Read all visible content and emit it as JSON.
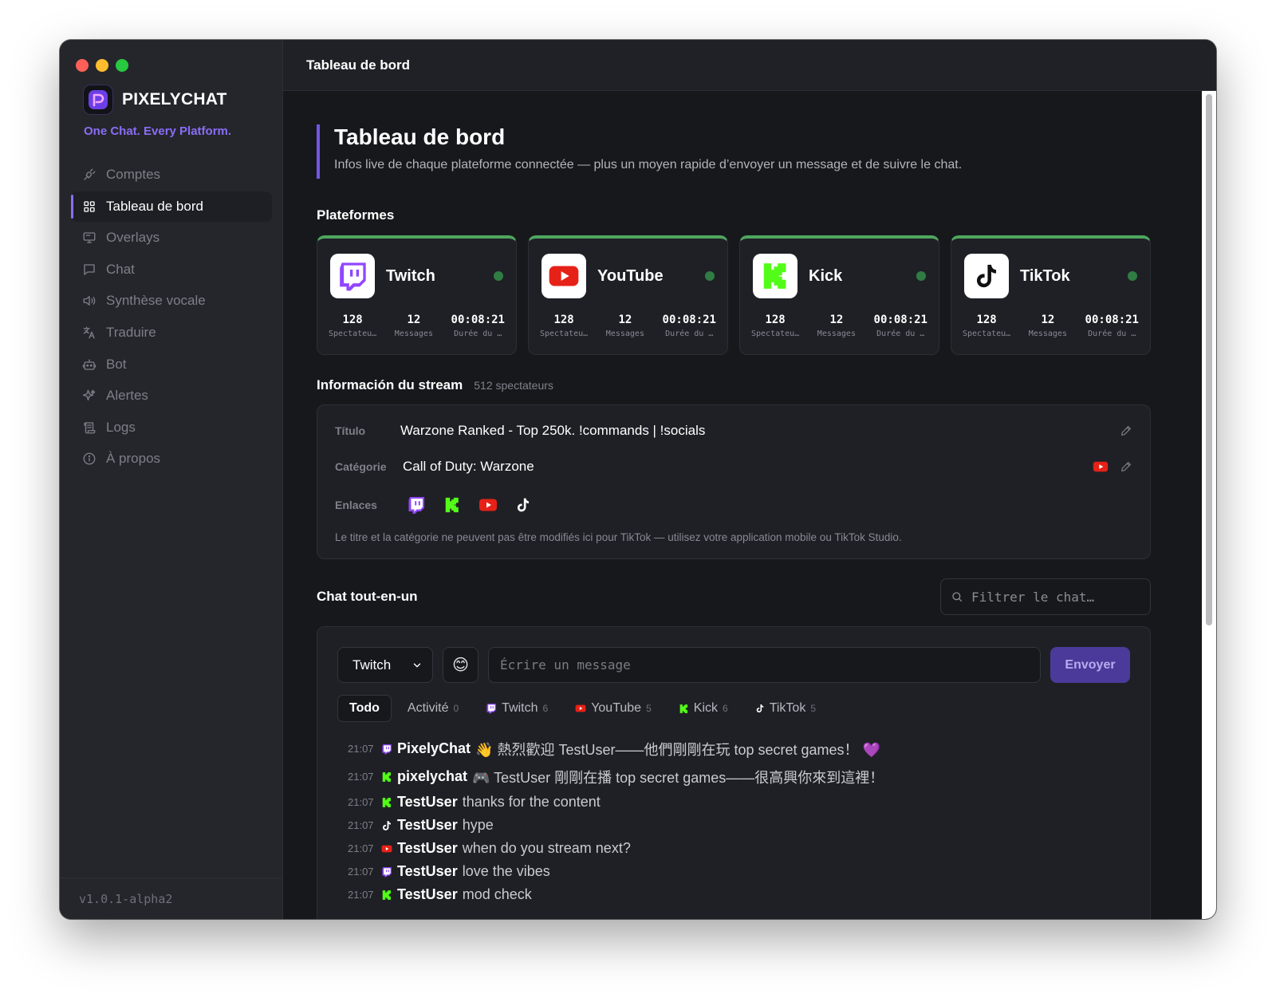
{
  "app": {
    "name": "PIXELYCHAT",
    "tagline": "One Chat. Every Platform.",
    "version": "v1.0.1-alpha2",
    "topbar_title": "Tableau de bord",
    "accent": "#8a6df5"
  },
  "sidebar": {
    "items": [
      {
        "label": "Comptes",
        "icon": "plug-icon"
      },
      {
        "label": "Tableau de bord",
        "icon": "grid-icon"
      },
      {
        "label": "Overlays",
        "icon": "monitor-icon"
      },
      {
        "label": "Chat",
        "icon": "message-icon"
      },
      {
        "label": "Synthèse vocale",
        "icon": "speaker-icon"
      },
      {
        "label": "Traduire",
        "icon": "translate-icon"
      },
      {
        "label": "Bot",
        "icon": "bot-icon"
      },
      {
        "label": "Alertes",
        "icon": "sparkles-icon"
      },
      {
        "label": "Logs",
        "icon": "scroll-icon"
      },
      {
        "label": "À propos",
        "icon": "info-icon"
      }
    ]
  },
  "page": {
    "title": "Tableau de bord",
    "subtitle": "Infos live de chaque plateforme connectée — plus un moyen rapide d’envoyer un message et de suivre le chat."
  },
  "platforms": {
    "title": "Plateformes",
    "cards": [
      {
        "name": "Twitch",
        "viewers": "128",
        "messages": "12",
        "duration": "00:08:21",
        "viewers_label": "Spectateu…",
        "messages_label": "Messages",
        "duration_label": "Durée du …",
        "color": "#9146ff"
      },
      {
        "name": "YouTube",
        "viewers": "128",
        "messages": "12",
        "duration": "00:08:21",
        "viewers_label": "Spectateu…",
        "messages_label": "Messages",
        "duration_label": "Durée du …",
        "color": "#e62117"
      },
      {
        "name": "Kick",
        "viewers": "128",
        "messages": "12",
        "duration": "00:08:21",
        "viewers_label": "Spectateu…",
        "messages_label": "Messages",
        "duration_label": "Durée du …",
        "color": "#53fc18"
      },
      {
        "name": "TikTok",
        "viewers": "128",
        "messages": "12",
        "duration": "00:08:21",
        "viewers_label": "Spectateu…",
        "messages_label": "Messages",
        "duration_label": "Durée du …",
        "color": "#000000"
      }
    ]
  },
  "stream": {
    "title": "Información du stream",
    "viewers": "512 spectateurs",
    "title_label": "Título",
    "title_value": "Warzone Ranked - Top 250k. !commands | !socials",
    "category_label": "Catégorie",
    "category_value": "Call of Duty: Warzone",
    "links_label": "Enlaces",
    "note": "Le titre et la catégorie ne peuvent pas être modifiés ici pour TikTok — utilisez votre application mobile ou TikTok Studio."
  },
  "chat": {
    "title": "Chat tout-en-un",
    "filter_placeholder": "Filtrer le chat…",
    "platform_select": "Twitch",
    "emoji": "😊",
    "message_placeholder": "Écrire un message",
    "send_label": "Envoyer",
    "tabs": [
      {
        "label": "Todo",
        "count": ""
      },
      {
        "label": "Activité",
        "count": "0"
      },
      {
        "label": "Twitch",
        "count": "6"
      },
      {
        "label": "YouTube",
        "count": "5"
      },
      {
        "label": "Kick",
        "count": "6"
      },
      {
        "label": "TikTok",
        "count": "5"
      }
    ],
    "messages": [
      {
        "time": "21:07",
        "platform": "twitch",
        "user": "PixelyChat",
        "text": "👋 熱烈歡迎 TestUser——他們剛剛在玩 top secret games！ 💜"
      },
      {
        "time": "21:07",
        "platform": "kick",
        "user": "pixelychat",
        "text": "🎮 TestUser 剛剛在播 top secret games——很高興你來到這裡！"
      },
      {
        "time": "21:07",
        "platform": "kick",
        "user": "TestUser",
        "text": "thanks for the content"
      },
      {
        "time": "21:07",
        "platform": "tiktok",
        "user": "TestUser",
        "text": "hype"
      },
      {
        "time": "21:07",
        "platform": "youtube",
        "user": "TestUser",
        "text": "when do you stream next?"
      },
      {
        "time": "21:07",
        "platform": "twitch",
        "user": "TestUser",
        "text": "love the vibes"
      },
      {
        "time": "21:07",
        "platform": "kick",
        "user": "TestUser",
        "text": "mod check"
      }
    ]
  }
}
